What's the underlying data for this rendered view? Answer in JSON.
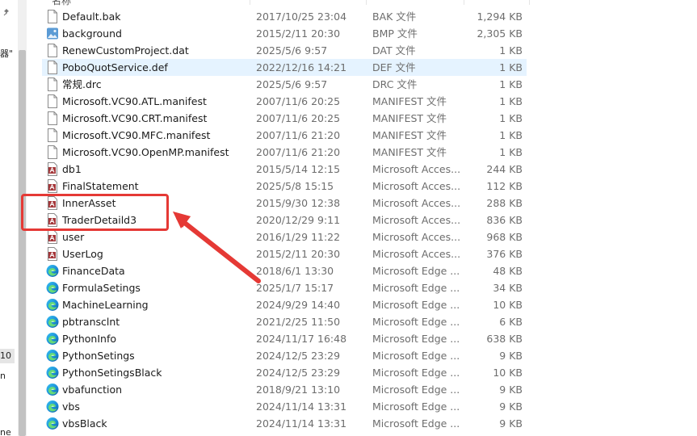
{
  "sidebar": {
    "fragments": [
      "器\"",
      "10",
      "n",
      "ne"
    ]
  },
  "columns": {
    "name_header": "名称"
  },
  "files": [
    {
      "name": "Default.bak",
      "date": "2017/10/25 23:04",
      "type": "BAK 文件",
      "size": "1,294 KB",
      "icon": "generic-file-icon"
    },
    {
      "name": "background",
      "date": "2015/2/11 20:30",
      "type": "BMP 文件",
      "size": "2,305 KB",
      "icon": "image-file-icon"
    },
    {
      "name": "RenewCustomProject.dat",
      "date": "2025/5/6 9:57",
      "type": "DAT 文件",
      "size": "1 KB",
      "icon": "generic-file-icon"
    },
    {
      "name": "PoboQuotService.def",
      "date": "2022/12/16 14:21",
      "type": "DEF 文件",
      "size": "1 KB",
      "icon": "generic-file-icon"
    },
    {
      "name": "常规.drc",
      "date": "2025/5/6 9:57",
      "type": "DRC 文件",
      "size": "1 KB",
      "icon": "generic-file-icon"
    },
    {
      "name": "Microsoft.VC90.ATL.manifest",
      "date": "2007/11/6 20:25",
      "type": "MANIFEST 文件",
      "size": "1 KB",
      "icon": "generic-file-icon"
    },
    {
      "name": "Microsoft.VC90.CRT.manifest",
      "date": "2007/11/6 20:25",
      "type": "MANIFEST 文件",
      "size": "1 KB",
      "icon": "generic-file-icon"
    },
    {
      "name": "Microsoft.VC90.MFC.manifest",
      "date": "2007/11/6 21:20",
      "type": "MANIFEST 文件",
      "size": "1 KB",
      "icon": "generic-file-icon"
    },
    {
      "name": "Microsoft.VC90.OpenMP.manifest",
      "date": "2007/11/6 21:20",
      "type": "MANIFEST 文件",
      "size": "1 KB",
      "icon": "generic-file-icon"
    },
    {
      "name": "db1",
      "date": "2015/5/14 12:15",
      "type": "Microsoft Acces...",
      "size": "244 KB",
      "icon": "access-db-icon"
    },
    {
      "name": "FinalStatement",
      "date": "2025/5/8 15:15",
      "type": "Microsoft Acces...",
      "size": "112 KB",
      "icon": "access-db-icon"
    },
    {
      "name": "InnerAsset",
      "date": "2015/9/30 12:38",
      "type": "Microsoft Acces...",
      "size": "288 KB",
      "icon": "access-db-icon"
    },
    {
      "name": "TraderDetaild3",
      "date": "2020/12/29 9:11",
      "type": "Microsoft Acces...",
      "size": "836 KB",
      "icon": "access-db-icon"
    },
    {
      "name": "user",
      "date": "2016/1/29 11:22",
      "type": "Microsoft Acces...",
      "size": "968 KB",
      "icon": "access-db-icon"
    },
    {
      "name": "UserLog",
      "date": "2015/2/11 20:30",
      "type": "Microsoft Acces...",
      "size": "376 KB",
      "icon": "access-db-icon"
    },
    {
      "name": "FinanceData",
      "date": "2018/6/1 13:30",
      "type": "Microsoft Edge ...",
      "size": "48 KB",
      "icon": "edge-icon"
    },
    {
      "name": "FormulaSetings",
      "date": "2025/1/7 15:17",
      "type": "Microsoft Edge ...",
      "size": "34 KB",
      "icon": "edge-icon"
    },
    {
      "name": "MachineLearning",
      "date": "2024/9/29 14:40",
      "type": "Microsoft Edge ...",
      "size": "10 KB",
      "icon": "edge-icon"
    },
    {
      "name": "pbtransclnt",
      "date": "2021/2/25 11:50",
      "type": "Microsoft Edge ...",
      "size": "6 KB",
      "icon": "edge-icon"
    },
    {
      "name": "PythonInfo",
      "date": "2024/11/17 16:48",
      "type": "Microsoft Edge ...",
      "size": "638 KB",
      "icon": "edge-icon"
    },
    {
      "name": "PythonSetings",
      "date": "2024/12/5 23:29",
      "type": "Microsoft Edge ...",
      "size": "9 KB",
      "icon": "edge-icon"
    },
    {
      "name": "PythonSetingsBlack",
      "date": "2024/12/5 23:29",
      "type": "Microsoft Edge ...",
      "size": "10 KB",
      "icon": "edge-icon"
    },
    {
      "name": "vbafunction",
      "date": "2018/9/21 13:10",
      "type": "Microsoft Edge ...",
      "size": "9 KB",
      "icon": "edge-icon"
    },
    {
      "name": "vbs",
      "date": "2024/11/14 13:31",
      "type": "Microsoft Edge ...",
      "size": "9 KB",
      "icon": "edge-icon"
    },
    {
      "name": "vbsBlack",
      "date": "2024/11/14 13:31",
      "type": "Microsoft Edge ...",
      "size": "9 KB",
      "icon": "edge-icon"
    }
  ],
  "selected_index": 3,
  "annotation": {
    "highlight_color": "#e53935"
  }
}
